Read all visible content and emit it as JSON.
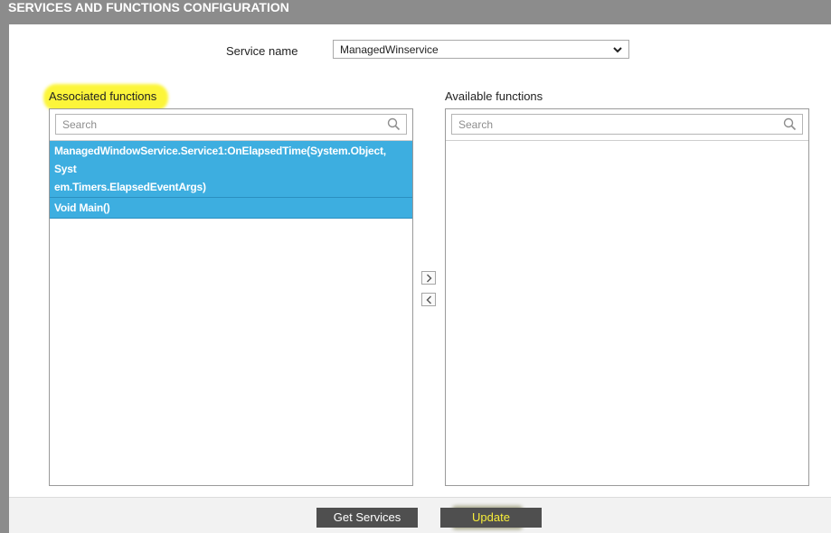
{
  "header": {
    "title": "SERVICES AND FUNCTIONS CONFIGURATION"
  },
  "service": {
    "label": "Service name",
    "selected": "ManagedWinservice"
  },
  "associated": {
    "label": "Associated functions",
    "search_placeholder": "Search",
    "items": [
      {
        "line1": "ManagedWindowService.Service1:OnElapsedTime(System.Object, Syst",
        "line2": "em.Timers.ElapsedEventArgs)"
      },
      {
        "line1": "Void Main()"
      }
    ]
  },
  "available": {
    "label": "Available functions",
    "search_placeholder": "Search",
    "items": []
  },
  "footer": {
    "get_services_label": "Get Services",
    "update_label": "Update"
  },
  "colors": {
    "selection": "#3daee0",
    "highlight": "#fcf53a",
    "button": "#4f4f4f"
  }
}
